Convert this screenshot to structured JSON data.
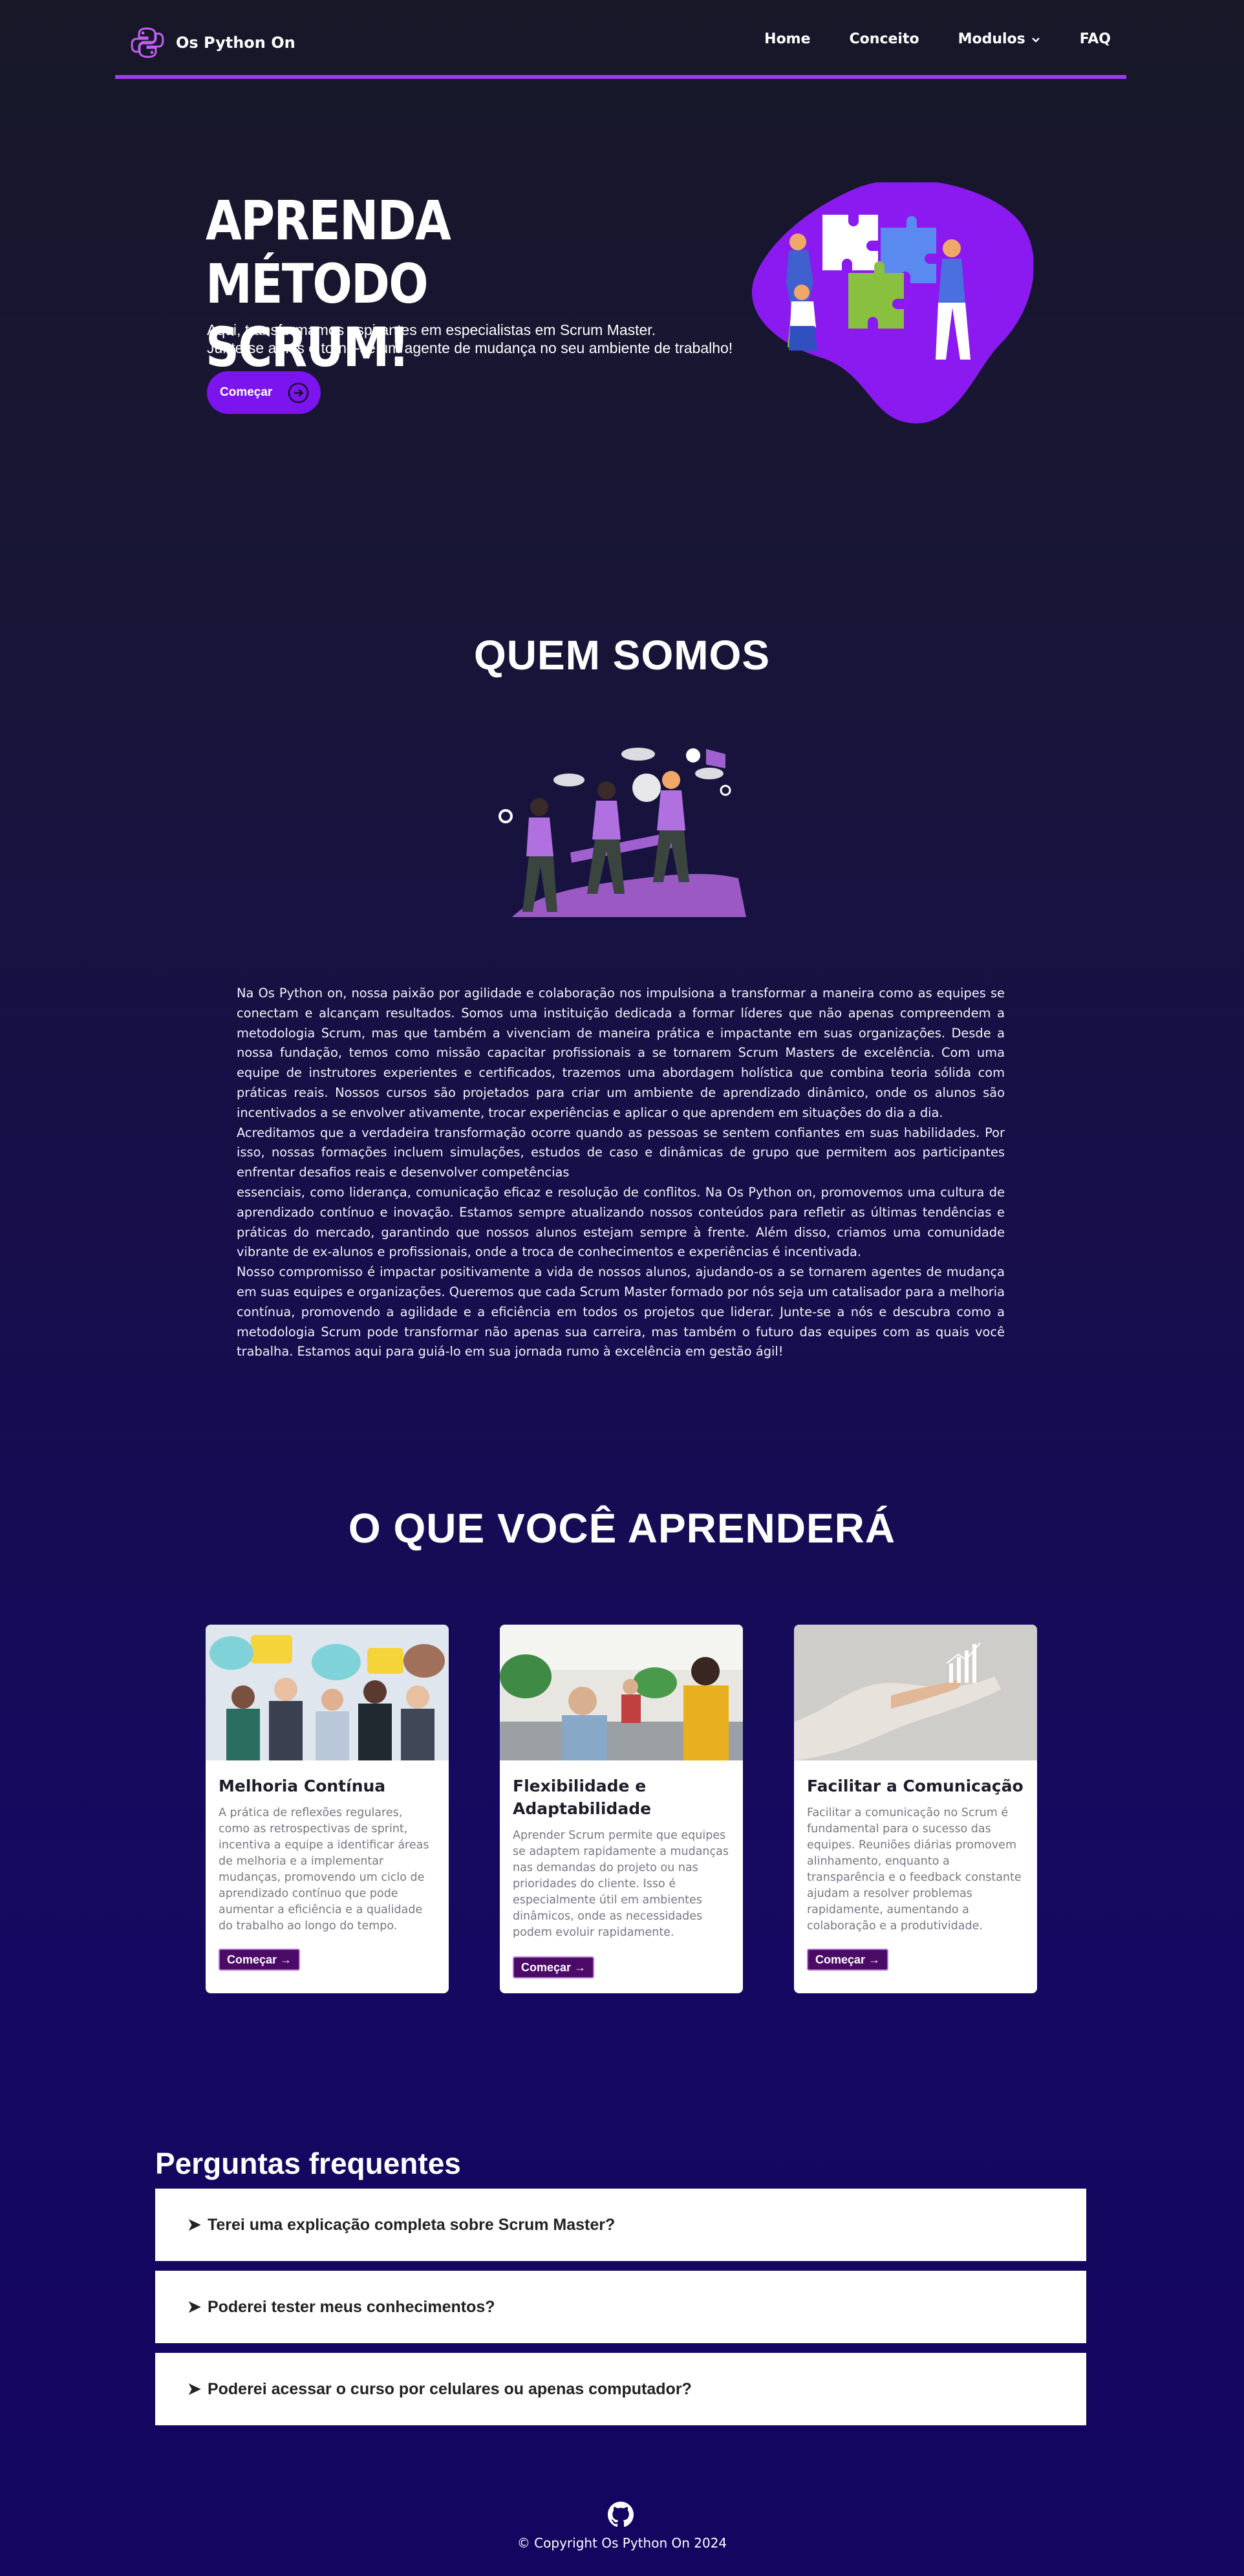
{
  "nav": {
    "brand": "Os Python On",
    "items": [
      "Home",
      "Conceito",
      "Modulos",
      "FAQ"
    ]
  },
  "hero": {
    "title_line1": "APRENDA",
    "title_line2": "MÉTODO SCRUM!",
    "subtitle_line1": "Aqui, transformamos aspirantes em especialistas em Scrum Master.",
    "subtitle_line2": "Junte-se a nós e torne-se um agente de mudança no seu ambiente de trabalho!",
    "cta": "Começar"
  },
  "about": {
    "title": "QUEM SOMOS",
    "paragraphs": [
      "Na Os Python on, nossa paixão por agilidade e colaboração nos impulsiona a transformar a maneira como as equipes se conectam e alcançam resultados. Somos uma instituição dedicada a formar líderes que não apenas compreendem a metodologia Scrum, mas que também a vivenciam de maneira prática e impactante em suas organizações. Desde a nossa fundação, temos como missão capacitar profissionais a se tornarem Scrum Masters de excelência. Com uma equipe de instrutores experientes e certificados, trazemos uma abordagem holística que combina teoria sólida com práticas reais. Nossos cursos são projetados para criar um ambiente de aprendizado dinâmico, onde os alunos são incentivados a se envolver ativamente, trocar experiências e aplicar o que aprendem em situações do dia a dia.",
      "Acreditamos que a verdadeira transformação ocorre quando as pessoas se sentem confiantes em suas habilidades. Por isso, nossas formações incluem simulações, estudos de caso e dinâmicas de grupo que permitem aos participantes enfrentar desafios reais e desenvolver competências",
      "essenciais, como liderança, comunicação eficaz e resolução de conflitos. Na Os Python on, promovemos uma cultura de aprendizado contínuo e inovação. Estamos sempre atualizando nossos conteúdos para refletir as últimas tendências e práticas do mercado, garantindo que nossos alunos estejam sempre à frente. Além disso, criamos uma comunidade vibrante de ex-alunos e profissionais, onde a troca de conhecimentos e experiências é incentivada.",
      "Nosso compromisso é impactar positivamente a vida de nossos alunos, ajudando-os a se tornarem agentes de mudança em suas equipes e organizações. Queremos que cada Scrum Master formado por nós seja um catalisador para a melhoria contínua, promovendo a agilidade e a eficiência em todos os projetos que liderar. Junte-se a nós e descubra como a metodologia Scrum pode transformar não apenas sua carreira, mas também o futuro das equipes com as quais você trabalha. Estamos aqui para guiá-lo em sua jornada rumo à excelência em gestão ágil!"
    ]
  },
  "learn": {
    "title": "O QUE VOCÊ APRENDERÁ",
    "cards": [
      {
        "title": "Melhoria Contínua",
        "text": "A prática de reflexões regulares, como as retrospectivas de sprint, incentiva a equipe a identificar áreas de melhoria e a implementar mudanças, promovendo um ciclo de aprendizado contínuo que pode aumentar a eficiência e a qualidade do trabalho ao longo do tempo.",
        "button": "Começar →"
      },
      {
        "title": "Flexibilidade e Adaptabilidade",
        "text": "Aprender Scrum permite que equipes se adaptem rapidamente a mudanças nas demandas do projeto ou nas prioridades do cliente. Isso é especialmente útil em ambientes dinâmicos, onde as necessidades podem evoluir rapidamente.",
        "button": "Começar →"
      },
      {
        "title": "Facilitar a Comunicação",
        "text": "Facilitar a comunicação no Scrum é fundamental para o sucesso das equipes. Reuniões diárias promovem alinhamento, enquanto a transparência e o feedback constante ajudam a resolver problemas rapidamente, aumentando a colaboração e a produtividade.",
        "button": "Começar →"
      }
    ]
  },
  "faq": {
    "title": "Perguntas frequentes",
    "questions": [
      "Terei uma explicação completa sobre Scrum Master?",
      "Poderei tester meus conhecimentos?",
      "Poderei acessar o curso por celulares ou apenas computador?"
    ]
  },
  "footer": {
    "icon": "github-icon",
    "copyright": "© Copyright Os Python On 2024"
  },
  "colors": {
    "accent": "#9b3fe8",
    "button": "#7b14ee",
    "card_button": "#4a0a66",
    "background_top": "#171728",
    "background_bottom": "#130560"
  }
}
